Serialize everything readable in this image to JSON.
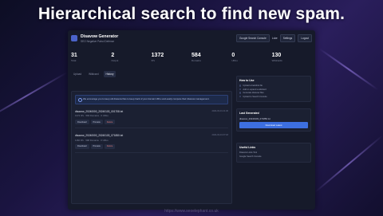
{
  "headline": "Hierarchical search to find new spam.",
  "watermark": "https://www.seoelephant.co.uk",
  "app": {
    "title": "Disavow Generator",
    "subtitle": "SEO Negative Patrol Defense",
    "header_buttons": {
      "search_console": "Google Search Console",
      "user": "Luke",
      "settings": "Settings",
      "logout": "Logout"
    },
    "stats": [
      {
        "value": "31",
        "label": "Total"
      },
      {
        "value": "2",
        "label": "Output"
      },
      {
        "value": "1372",
        "label": "IPs"
      },
      {
        "value": "584",
        "label": "Domains"
      },
      {
        "value": "0",
        "label": "URLs"
      },
      {
        "value": "130",
        "label": "Wildcards"
      }
    ],
    "tabs": [
      "Upload",
      "Wildcard",
      "History"
    ],
    "alert": "We encourage you to keep old disavow files to keep track of your domain URLs and easily compare their disavow management.",
    "files": [
      {
        "name": "disavow_20240000_20240103_001708.txt",
        "meta": "1372 IPs · 584 Domains · 0 URLs",
        "date": "2024-03-01 21:36",
        "actions": [
          "Download",
          "Preview",
          "Delete"
        ]
      },
      {
        "name": "disavow_20240000_20240103_071850.txt",
        "meta": "1160 IPs · 598 Domains · 0 URLs",
        "date": "2024-03-01 07:18",
        "actions": [
          "Download",
          "Preview",
          "Delete"
        ]
      }
    ],
    "how_to_use": {
      "title": "How to Use",
      "steps": [
        "Upload a backlink file",
        "Add or expand a wildcard",
        "Generate disavow files",
        "Upload to Search Console"
      ]
    },
    "last_generated": {
      "title": "Last Generated",
      "file": "disavow_20240103_071850.txt",
      "button": "Download Latest"
    },
    "useful_links": {
      "title": "Useful Links",
      "links": [
        "Disavow Links Tool",
        "Google Search Console"
      ]
    }
  }
}
